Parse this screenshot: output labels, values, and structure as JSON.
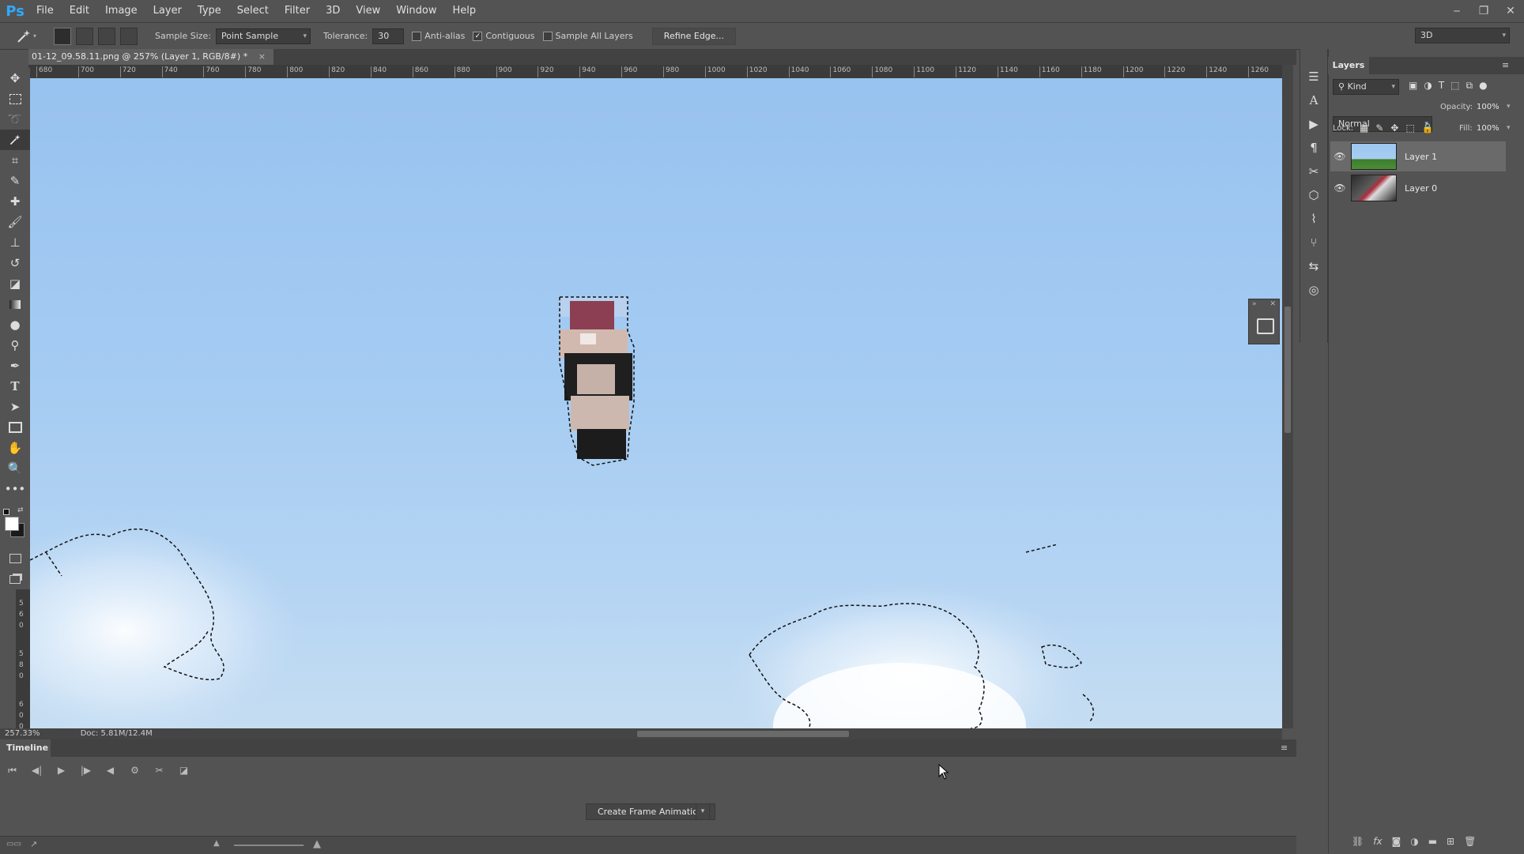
{
  "app": {
    "logo": "Ps"
  },
  "menu": [
    "File",
    "Edit",
    "Image",
    "Layer",
    "Type",
    "Select",
    "Filter",
    "3D",
    "View",
    "Window",
    "Help"
  ],
  "window_controls": {
    "minimize": "‒",
    "restore": "❐",
    "close": "✕"
  },
  "options_bar": {
    "sample_size_label": "Sample Size:",
    "sample_size_value": "Point Sample",
    "tolerance_label": "Tolerance:",
    "tolerance_value": "30",
    "anti_alias_label": "Anti-alias",
    "anti_alias_checked": false,
    "contiguous_label": "Contiguous",
    "contiguous_checked": true,
    "sample_all_layers_label": "Sample All Layers",
    "sample_all_layers_checked": false,
    "refine_edge_label": "Refine Edge...",
    "workspace_value": "3D"
  },
  "document": {
    "tab_title": "01-12_09.58.11.png @ 257% (Layer 1, RGB/8#) *",
    "tab_close": "×"
  },
  "ruler_top": [
    "680",
    "700",
    "720",
    "740",
    "760",
    "780",
    "800",
    "820",
    "840",
    "860",
    "880",
    "900",
    "920",
    "940",
    "960",
    "980",
    "1000",
    "1020",
    "1040",
    "1060",
    "1080",
    "1100",
    "1120",
    "1140",
    "1160",
    "1180",
    "1200",
    "1220",
    "1240",
    "1260"
  ],
  "ruler_left": [
    "5",
    "6",
    "0",
    "5",
    "8",
    "0",
    "6",
    "0",
    "0"
  ],
  "status": {
    "zoom": "257.33%",
    "doc": "Doc: 5.81M/12.4M"
  },
  "layers_panel": {
    "title": "Layers",
    "filter_kind": "Kind",
    "blend_mode": "Normal",
    "opacity_label": "Opacity:",
    "opacity_value": "100%",
    "lock_label": "Lock:",
    "fill_label": "Fill:",
    "fill_value": "100%",
    "layers": [
      {
        "name": "Layer 1",
        "visible": true,
        "selected": true
      },
      {
        "name": "Layer 0",
        "visible": true,
        "selected": false
      }
    ]
  },
  "timeline": {
    "title": "Timeline",
    "create_button": "Create Frame Animation"
  },
  "colors": {
    "ui_bg": "#535353",
    "ui_dark": "#424242",
    "canvas_sky": "#a4cbf2",
    "accent": "#31a8ff"
  }
}
